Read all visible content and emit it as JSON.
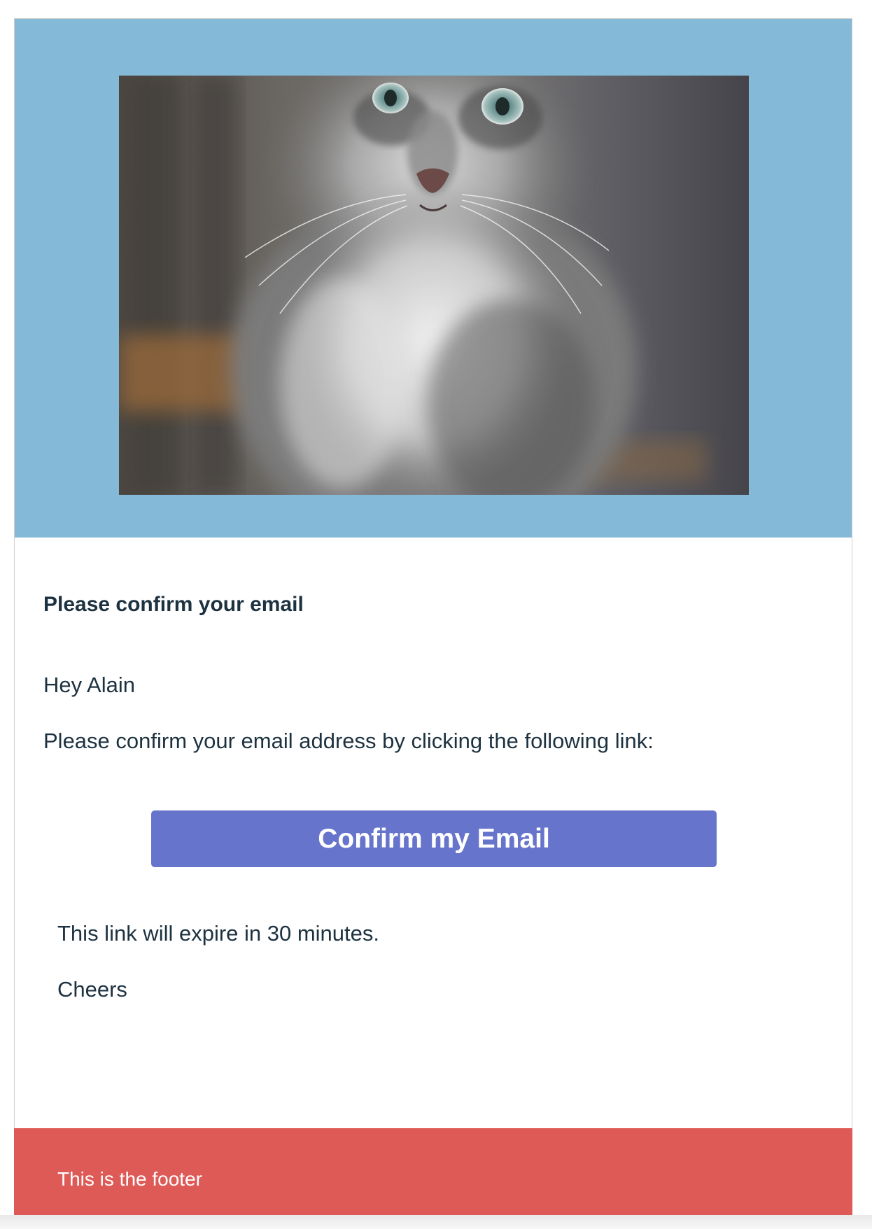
{
  "email": {
    "heading": "Please confirm your email",
    "greeting": "Hey Alain",
    "instruction": "Please confirm your email address by clicking the following link:",
    "button_label": "Confirm my Email",
    "expiry_note": "This link will expire in 30 minutes.",
    "signoff": "Cheers",
    "footer_text": "This is the footer"
  },
  "hero": {
    "image_subject": "kitten-photo"
  },
  "colors": {
    "hero_background": "#84b9d8",
    "text": "#1d3240",
    "button": "#6674cc",
    "footer": "#de5a57"
  }
}
